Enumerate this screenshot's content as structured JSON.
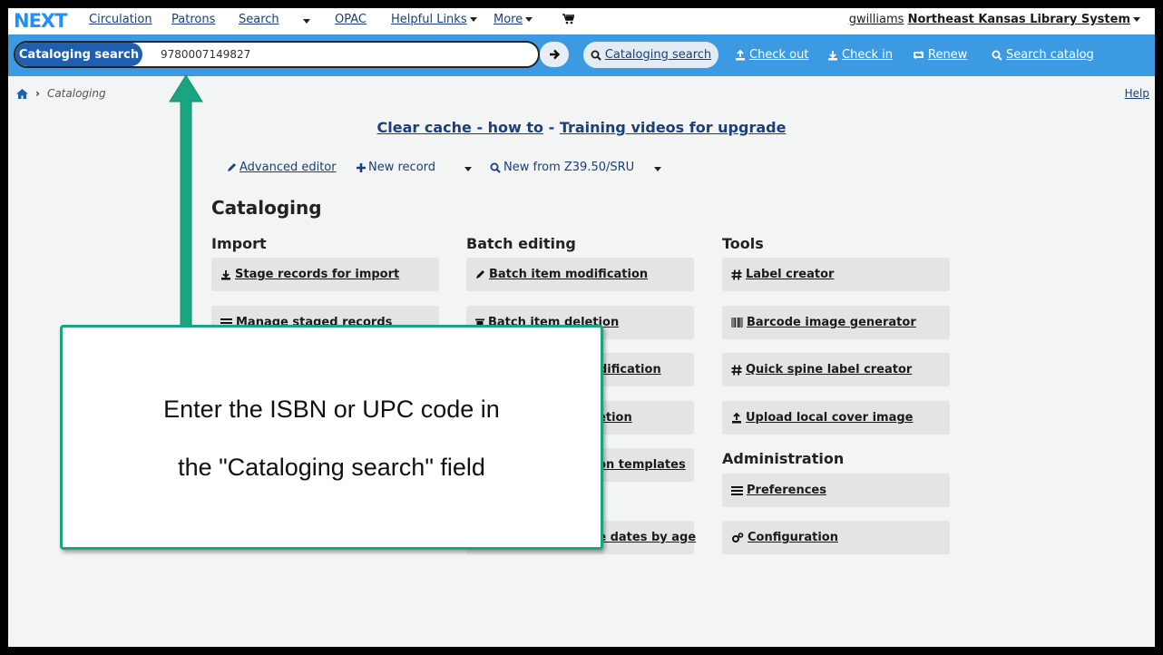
{
  "nav": {
    "logo": "NEXT",
    "links": [
      "Circulation",
      "Patrons",
      "Search",
      "OPAC",
      "Helpful Links",
      "More"
    ],
    "user": "gwilliams",
    "library": "Northeast Kansas Library System"
  },
  "search": {
    "type_label": "Cataloging search",
    "value": "9780007149827",
    "buttons": [
      "Cataloging search",
      "Check out",
      "Check in",
      "Renew",
      "Search catalog"
    ]
  },
  "breadcrumb": {
    "current": "Cataloging",
    "help": "Help"
  },
  "announcement": {
    "link1": "Clear cache - how to",
    "sep": "-",
    "link2": "Training videos for upgrade"
  },
  "toolbar": {
    "advanced": "Advanced editor",
    "new_record": "New record",
    "z3950": "New from Z39.50/SRU"
  },
  "page_title": "Cataloging",
  "columns": {
    "import": {
      "title": "Import",
      "items": [
        "Stage records for import",
        "Manage staged records"
      ]
    },
    "batch": {
      "title": "Batch editing",
      "items": [
        "Batch item modification",
        "Batch item deletion",
        "Batch record modification",
        "Batch record deletion",
        "MARC modification templates",
        "Batch extend due dates by age"
      ]
    },
    "tools": {
      "title": "Tools",
      "items": [
        "Label creator",
        "Barcode image generator",
        "Quick spine label creator",
        "Upload local cover image"
      ]
    },
    "admin": {
      "title": "Administration",
      "items": [
        "Preferences",
        "Configuration"
      ]
    }
  },
  "callout": {
    "line1": "Enter the ISBN or UPC code in",
    "line2": "the \"Cataloging search\" field"
  },
  "colors": {
    "nav_blue": "#3b9ae1",
    "pill_blue": "#1f5fb0",
    "callout_border": "#18a57f",
    "link": "#1a3f7a"
  }
}
